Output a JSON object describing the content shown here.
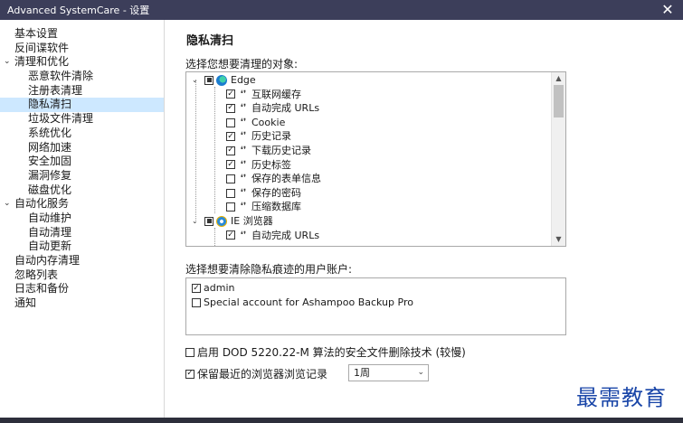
{
  "window": {
    "title": "Advanced SystemCare - 设置",
    "close_glyph": "✕"
  },
  "sidebar": {
    "items": [
      {
        "label": "基本设置",
        "level": 0
      },
      {
        "label": "反间谍软件",
        "level": 0
      },
      {
        "label": "清理和优化",
        "level": 0,
        "expanded": true
      },
      {
        "label": "恶意软件清除",
        "level": 1
      },
      {
        "label": "注册表清理",
        "level": 1
      },
      {
        "label": "隐私清扫",
        "level": 1,
        "selected": true
      },
      {
        "label": "垃圾文件清理",
        "level": 1
      },
      {
        "label": "系统优化",
        "level": 1
      },
      {
        "label": "网络加速",
        "level": 1
      },
      {
        "label": "安全加固",
        "level": 1
      },
      {
        "label": "漏洞修复",
        "level": 1
      },
      {
        "label": "磁盘优化",
        "level": 1
      },
      {
        "label": "自动化服务",
        "level": 0,
        "expanded": true
      },
      {
        "label": "自动维护",
        "level": 1
      },
      {
        "label": "自动清理",
        "level": 1
      },
      {
        "label": "自动更新",
        "level": 1
      },
      {
        "label": "自动内存清理",
        "level": 0
      },
      {
        "label": "忽略列表",
        "level": 0
      },
      {
        "label": "日志和备份",
        "level": 0
      },
      {
        "label": "通知",
        "level": 0
      }
    ]
  },
  "main": {
    "title": "隐私清扫",
    "objects_label": "选择您想要清理的对象:",
    "tree": [
      {
        "label": "Edge",
        "type": "parent",
        "icon": "edge-icon",
        "state": "partial"
      },
      {
        "label": "互联网缓存",
        "type": "child",
        "checked": true
      },
      {
        "label": "自动完成 URLs",
        "type": "child",
        "checked": true
      },
      {
        "label": "Cookie",
        "type": "child",
        "checked": false
      },
      {
        "label": "历史记录",
        "type": "child",
        "checked": true
      },
      {
        "label": "下载历史记录",
        "type": "child",
        "checked": true
      },
      {
        "label": "历史标签",
        "type": "child",
        "checked": true
      },
      {
        "label": "保存的表单信息",
        "type": "child",
        "checked": false
      },
      {
        "label": "保存的密码",
        "type": "child",
        "checked": false
      },
      {
        "label": "压缩数据库",
        "type": "child",
        "checked": false
      },
      {
        "label": "IE 浏览器",
        "type": "parent",
        "icon": "ie-icon",
        "state": "partial"
      },
      {
        "label": "自动完成 URLs",
        "type": "child",
        "checked": true
      }
    ],
    "accounts_label": "选择想要清除隐私痕迹的用户账户:",
    "accounts": [
      {
        "label": "admin",
        "checked": true
      },
      {
        "label": "Special account for Ashampoo Backup Pro",
        "checked": false
      }
    ],
    "dod_option": {
      "label": "启用 DOD 5220.22-M 算法的安全文件删除技术 (较慢)",
      "checked": false
    },
    "keep_history_option": {
      "label": "保留最近的浏览器浏览记录",
      "checked": true
    },
    "keep_history_select": {
      "value": "1周"
    }
  },
  "watermark": "最需教育"
}
